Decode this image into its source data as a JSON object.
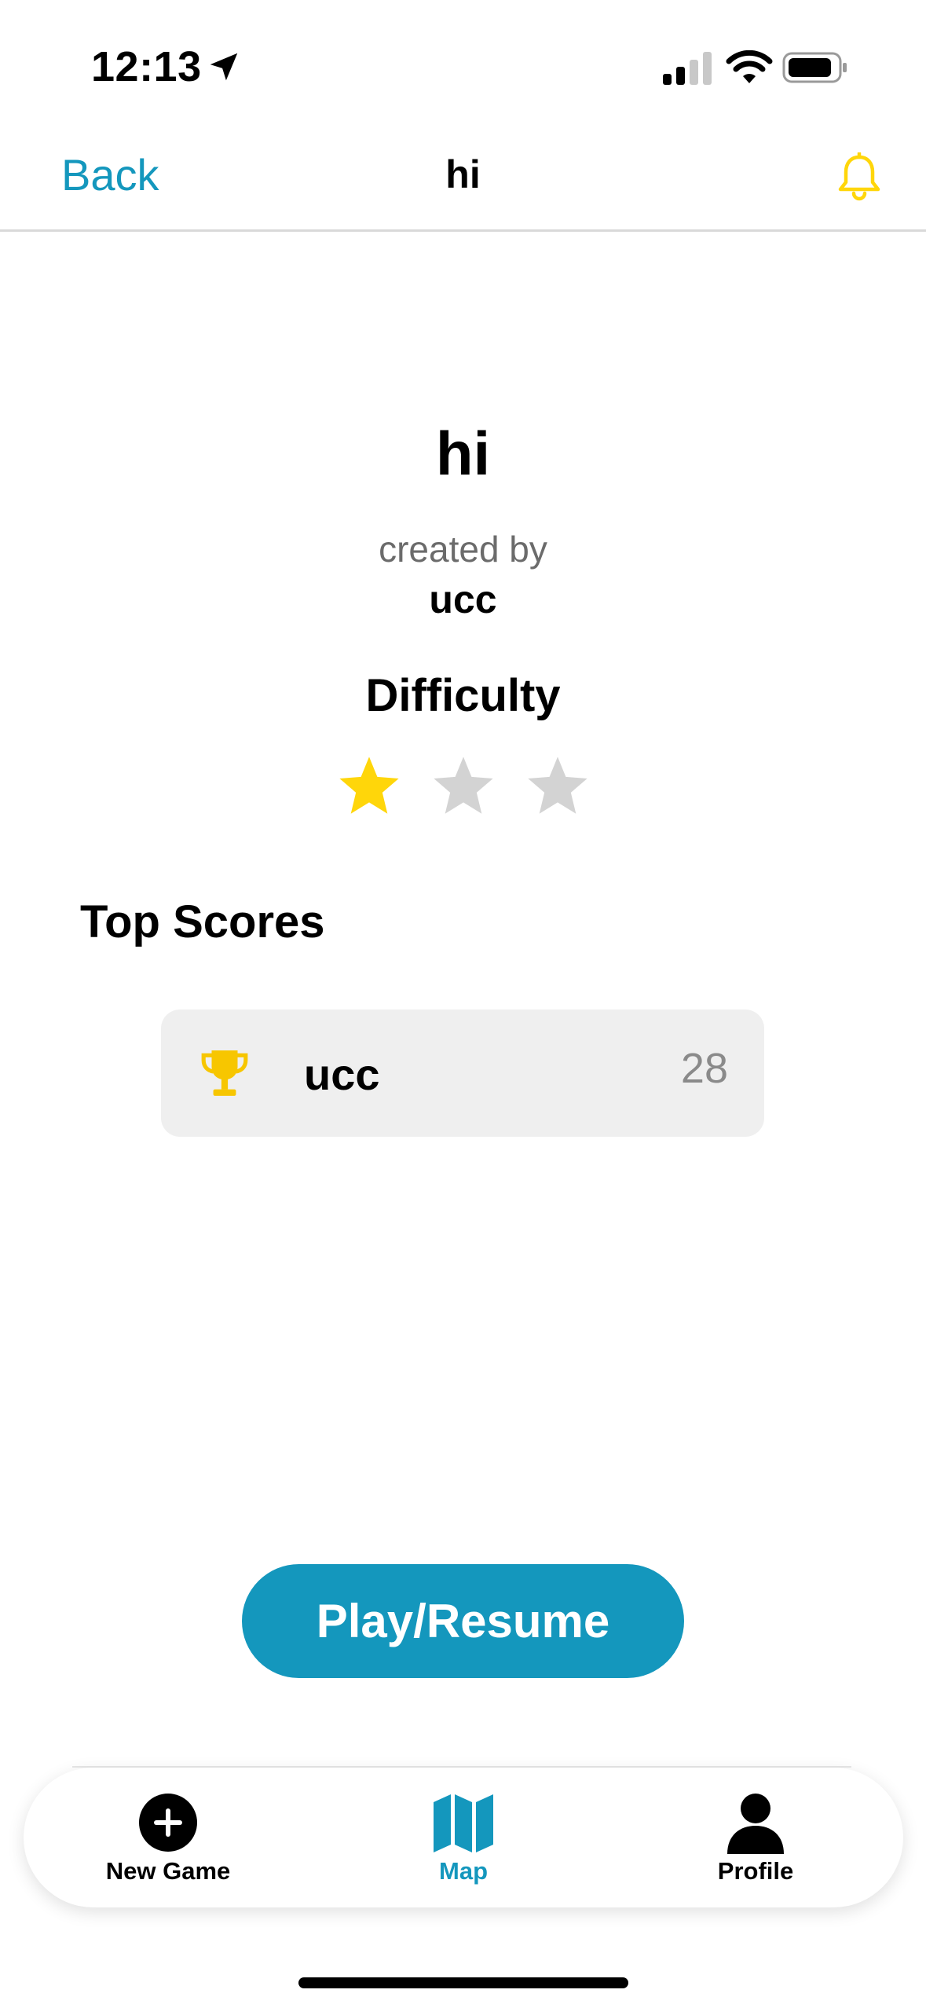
{
  "status_bar": {
    "time": "12:13"
  },
  "nav": {
    "back_label": "Back",
    "title": "hi"
  },
  "game": {
    "title": "hi",
    "created_by_label": "created by",
    "creator": "ucc",
    "difficulty_label": "Difficulty",
    "difficulty_rating": 1,
    "difficulty_max": 3
  },
  "top_scores": {
    "heading": "Top Scores",
    "entries": [
      {
        "name": "ucc",
        "score": "28",
        "icon": "trophy-icon"
      }
    ]
  },
  "play_button": {
    "label": "Play/Resume"
  },
  "tab_bar": {
    "items": [
      {
        "label": "New Game",
        "icon": "plus-circle-icon",
        "active": false
      },
      {
        "label": "Map",
        "icon": "map-icon",
        "active": true
      },
      {
        "label": "Profile",
        "icon": "person-icon",
        "active": false
      }
    ]
  },
  "colors": {
    "accent": "#1497bd",
    "star_filled": "#ffd60a",
    "star_empty": "#d3d3d3",
    "trophy": "#f7c600",
    "bell": "#ffd60a"
  }
}
